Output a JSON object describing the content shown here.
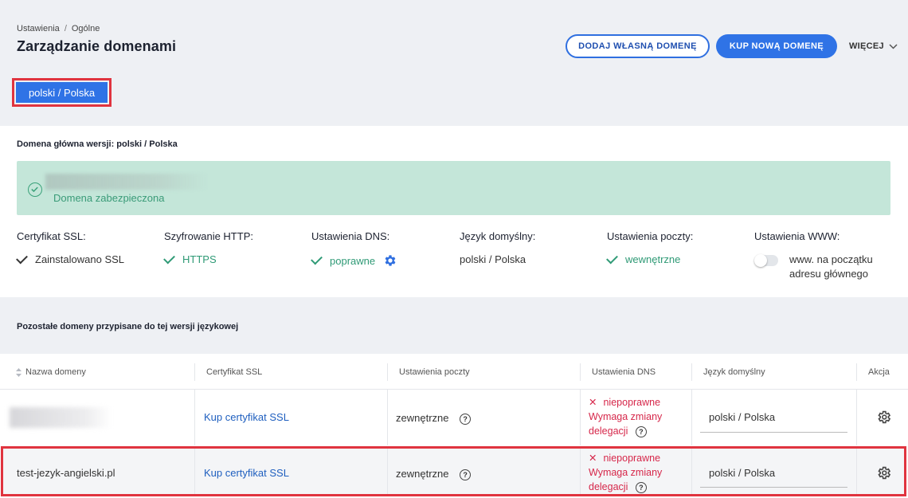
{
  "breadcrumb": {
    "parent": "Ustawienia",
    "separator": "/",
    "current": "Ogólne"
  },
  "page_title": "Zarządzanie domenami",
  "actions": {
    "add_own_domain": "DODAJ WŁASNĄ DOMENĘ",
    "buy_new_domain": "KUP NOWĄ DOMENĘ",
    "more": "WIĘCEJ"
  },
  "language_tab": "polski / Polska",
  "main_domain": {
    "title": "Domena główna wersji: polski / Polska",
    "status": "Domena zabezpieczona",
    "stats": {
      "ssl": {
        "label": "Certyfikat SSL:",
        "value": "Zainstalowano SSL"
      },
      "http": {
        "label": "Szyfrowanie HTTP:",
        "value": "HTTPS"
      },
      "dns": {
        "label": "Ustawienia DNS:",
        "value": "poprawne"
      },
      "lang": {
        "label": "Język domyślny:",
        "value": "polski / Polska"
      },
      "mail": {
        "label": "Ustawienia poczty:",
        "value": "wewnętrzne"
      },
      "www": {
        "label": "Ustawienia WWW:",
        "value": "www. na początku adresu głównego"
      }
    }
  },
  "other_domains": {
    "title": "Pozostałe domeny przypisane do tej wersji językowej",
    "columns": {
      "name": "Nazwa domeny",
      "ssl": "Certyfikat SSL",
      "mail": "Ustawienia poczty",
      "dns": "Ustawienia DNS",
      "lang": "Język domyślny",
      "action": "Akcja"
    },
    "rows": [
      {
        "name": "",
        "ssl": "Kup certyfikat SSL",
        "mail": "zewnętrzne",
        "dns_status": "niepoprawne",
        "dns_note": "Wymaga zmiany delegacji",
        "lang": "polski / Polska"
      },
      {
        "name": "test-jezyk-angielski.pl",
        "ssl": "Kup certyfikat SSL",
        "mail": "zewnętrzne",
        "dns_status": "niepoprawne",
        "dns_note": "Wymaga zmiany delegacji",
        "lang": "polski / Polska"
      }
    ]
  },
  "colors": {
    "accent": "#2f73e6",
    "success": "#2f9a76",
    "error": "#d6274a",
    "highlight": "#e0343f"
  }
}
